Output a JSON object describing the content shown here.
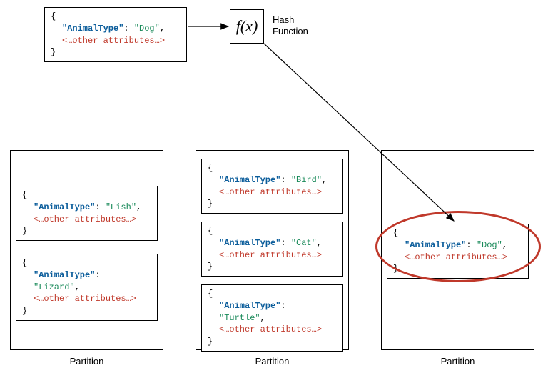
{
  "input": {
    "keyLabel": "\"AnimalType\"",
    "value": "\"Dog\"",
    "other": "<…other attributes…>"
  },
  "hash": {
    "symbol": "f(x)",
    "label1": "Hash",
    "label2": "Function"
  },
  "partitions": [
    {
      "label": "Partition",
      "items": [
        {
          "keyLabel": "\"AnimalType\"",
          "value": "\"Fish\"",
          "other": "<…other attributes…>"
        },
        {
          "keyLabel": "\"AnimalType\"",
          "value": "\"Lizard\"",
          "other": "<…other attributes…>"
        }
      ]
    },
    {
      "label": "Partition",
      "items": [
        {
          "keyLabel": "\"AnimalType\"",
          "value": "\"Bird\"",
          "other": "<…other attributes…>"
        },
        {
          "keyLabel": "\"AnimalType\"",
          "value": "\"Cat\"",
          "other": "<…other attributes…>"
        },
        {
          "keyLabel": "\"AnimalType\"",
          "value": "\"Turtle\"",
          "other": "<…other attributes…>"
        }
      ]
    },
    {
      "label": "Partition",
      "items": [
        {
          "keyLabel": "\"AnimalType\"",
          "value": "\"Dog\"",
          "other": "<…other attributes…>"
        }
      ]
    }
  ]
}
